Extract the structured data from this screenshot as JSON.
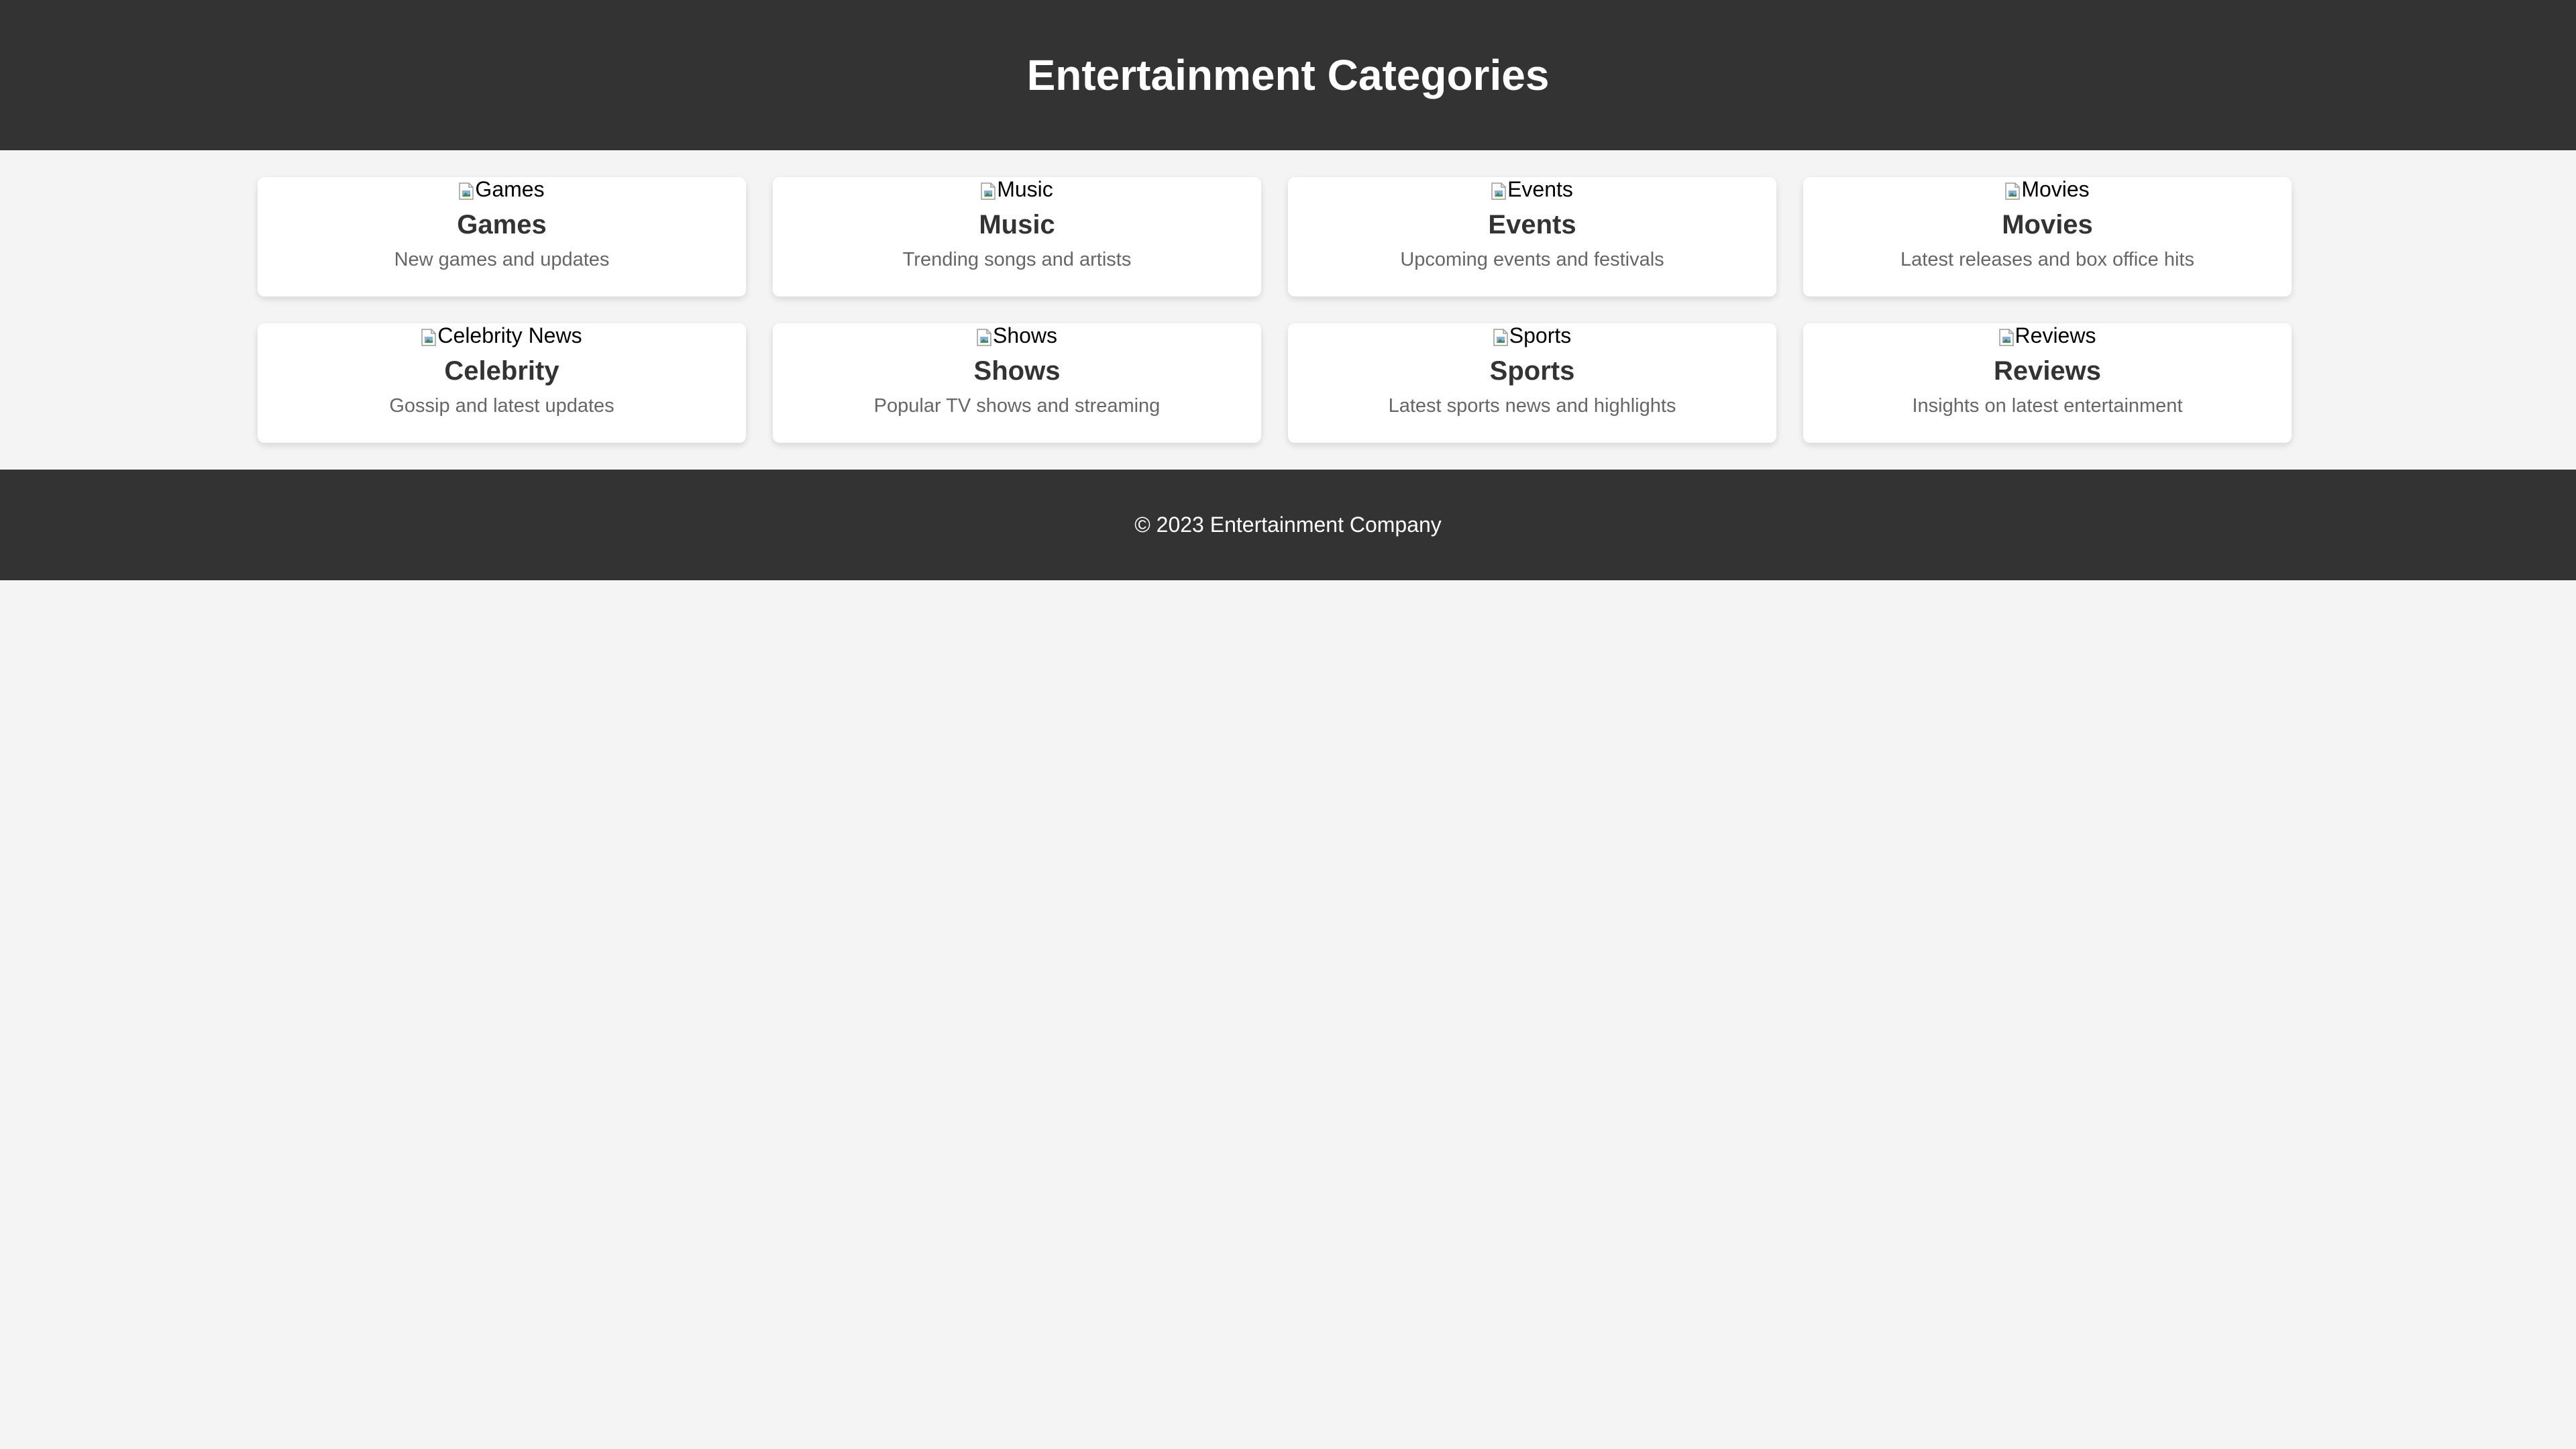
{
  "header": {
    "title": "Entertainment Categories"
  },
  "cards": [
    {
      "img_alt": "Games",
      "title": "Games",
      "description": "New games and updates"
    },
    {
      "img_alt": "Music",
      "title": "Music",
      "description": "Trending songs and artists"
    },
    {
      "img_alt": "Events",
      "title": "Events",
      "description": "Upcoming events and festivals"
    },
    {
      "img_alt": "Movies",
      "title": "Movies",
      "description": "Latest releases and box office hits"
    },
    {
      "img_alt": "Celebrity News",
      "title": "Celebrity",
      "description": "Gossip and latest updates"
    },
    {
      "img_alt": "Shows",
      "title": "Shows",
      "description": "Popular TV shows and streaming"
    },
    {
      "img_alt": "Sports",
      "title": "Sports",
      "description": "Latest sports news and highlights"
    },
    {
      "img_alt": "Reviews",
      "title": "Reviews",
      "description": "Insights on latest entertainment"
    }
  ],
  "footer": {
    "copyright": "© 2023 Entertainment Company"
  },
  "colors": {
    "header_bg": "#333333",
    "page_bg": "#f4f4f4",
    "card_bg": "#ffffff",
    "title_text": "#333333",
    "desc_text": "#666666"
  }
}
